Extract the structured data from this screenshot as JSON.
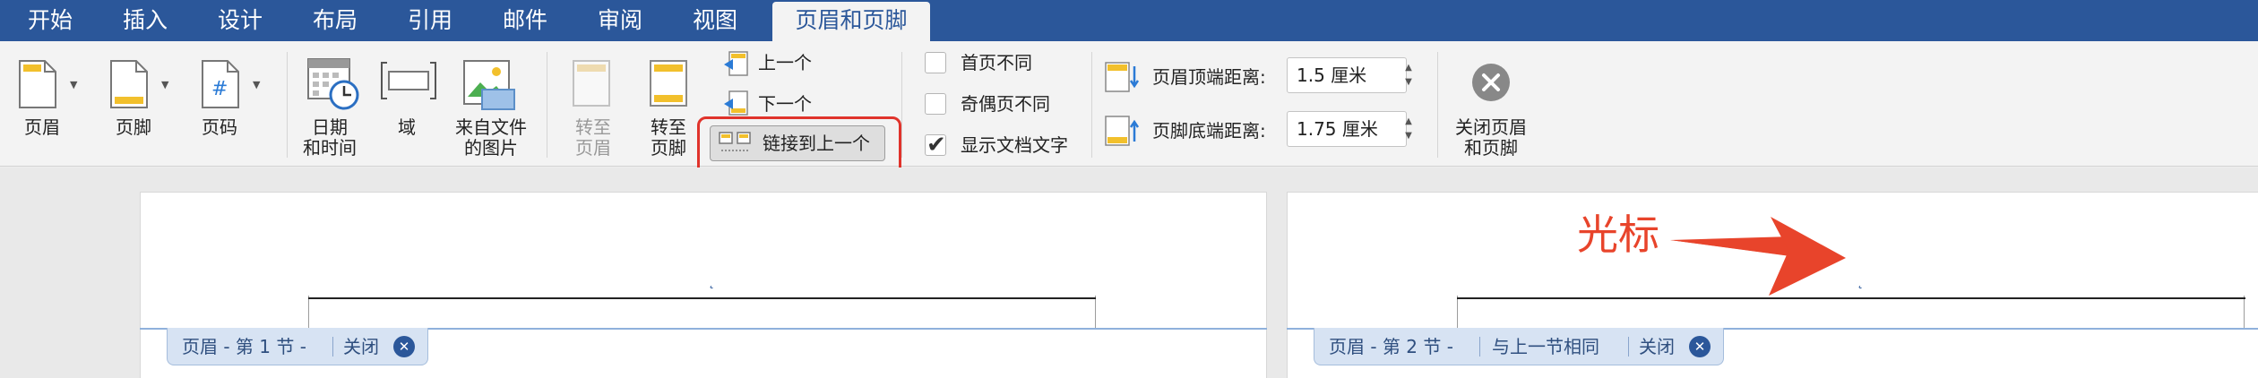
{
  "tabs": [
    "开始",
    "插入",
    "设计",
    "布局",
    "引用",
    "邮件",
    "审阅",
    "视图",
    "页眉和页脚"
  ],
  "ribbon": {
    "header_label": "页眉",
    "footer_label": "页脚",
    "page_number_label": "页码",
    "datetime_label_1": "日期",
    "datetime_label_2": "和时间",
    "field_label": "域",
    "picture_label_1": "来自文件",
    "picture_label_2": "的图片",
    "goto_header_label_1": "转至",
    "goto_header_label_2": "页眉",
    "goto_footer_label_1": "转至",
    "goto_footer_label_2": "页脚",
    "previous_label": "上一个",
    "next_label": "下一个",
    "link_to_previous_label": "链接到上一个",
    "first_page_diff_label": "首页不同",
    "odd_even_diff_label": "奇偶页不同",
    "show_doc_text_label": "显示文档文字",
    "header_top_label": "页眉顶端距离:",
    "header_top_value": "1.5 厘米",
    "footer_bottom_label": "页脚底端距离:",
    "footer_bottom_value": "1.75 厘米",
    "close_label_1": "关闭页眉",
    "close_label_2": "和页脚"
  },
  "checkboxes": {
    "first_page_diff": false,
    "odd_even_diff": false,
    "show_doc_text": true
  },
  "page1": {
    "tag_label": "页眉 - 第 1 节 -",
    "close_label": "关闭"
  },
  "page2": {
    "tag_label": "页眉 - 第 2 节 -",
    "same_as_prev_label": "与上一节相同",
    "close_label": "关闭"
  },
  "annotation": {
    "text": "光标",
    "color": "#e8442b"
  },
  "colors": {
    "tab_bar": "#2b579a",
    "highlight": "#e0332b",
    "header_tag": "#d7e3f3"
  }
}
